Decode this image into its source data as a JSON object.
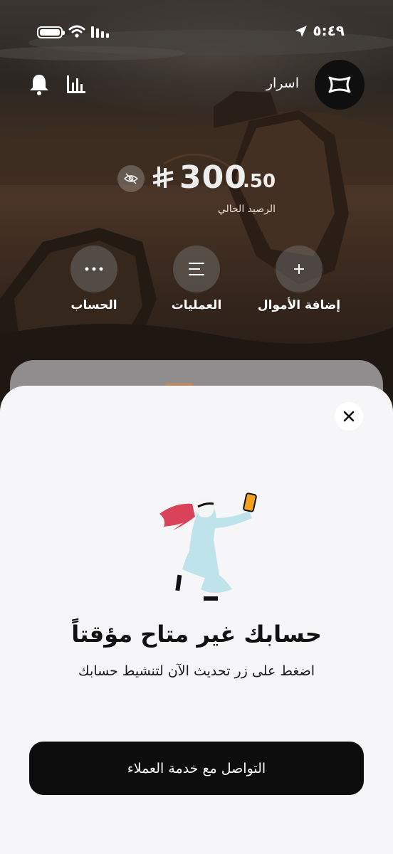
{
  "status_bar": {
    "time": "٥:٤٩"
  },
  "header": {
    "username": "اسرار"
  },
  "balance": {
    "integer": "300",
    "decimal": ".50",
    "label": "الرصيد الحالي"
  },
  "actions": [
    {
      "label": "إضافة الأموال",
      "icon": "plus-icon"
    },
    {
      "label": "العمليات",
      "icon": "list-icon"
    },
    {
      "label": "الحساب",
      "icon": "more-icon"
    }
  ],
  "sheet": {
    "title": "حسابك غير متاح مؤقتاً",
    "subtitle": "اضغط على زر تحديث الآن لتنشيط حسابك",
    "cta_label": "التواصل مع خدمة العملاء"
  },
  "colors": {
    "sheet_bg": "#f6f6f8",
    "cta_bg": "#0d0d0d",
    "scarf_red": "#d9435a",
    "robe_blue": "#bfe3ea",
    "phone_orange": "#f2a21c"
  }
}
